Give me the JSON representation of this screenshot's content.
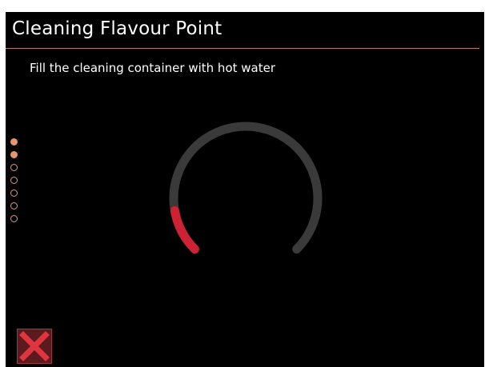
{
  "header": {
    "title": "Cleaning Flavour Point"
  },
  "instruction": {
    "text": "Fill the cleaning container with hot water"
  },
  "steps": {
    "total": 7,
    "completed": 2
  },
  "progress_gauge": {
    "fraction": 0.13,
    "fill_color": "#cc2233",
    "track_color": "#3a3a3a"
  },
  "colors": {
    "background": "#000000",
    "accent": "#e8956a",
    "cancel": "#e0353f"
  },
  "icons": {
    "close": "close-icon"
  }
}
